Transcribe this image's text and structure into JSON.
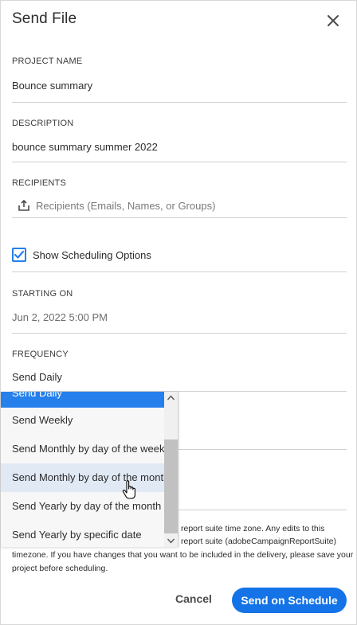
{
  "dialog": {
    "title": "Send File",
    "close_icon": "close-icon"
  },
  "project_name": {
    "label": "PROJECT NAME",
    "value": "Bounce summary"
  },
  "description": {
    "label": "DESCRIPTION",
    "value": "bounce summary summer 2022"
  },
  "recipients": {
    "label": "RECIPIENTS",
    "placeholder": "Recipients (Emails, Names, or Groups)",
    "icon": "share-icon"
  },
  "scheduling": {
    "checkbox_label": "Show Scheduling Options",
    "checked": true
  },
  "starting_on": {
    "label": "STARTING ON",
    "value": "Jun 2, 2022 5:00 PM"
  },
  "frequency": {
    "label": "FREQUENCY",
    "value": "Send Daily",
    "options": [
      "Send Daily",
      "Send Weekly",
      "Send Monthly by day of the week",
      "Send Monthly by day of the month",
      "Send Yearly by day of the month",
      "Send Yearly by specific date"
    ],
    "selected_option": "Send Daily",
    "hovered_option": "Send Monthly by day of the month"
  },
  "note": {
    "line1": "report suite time zone. Any edits to this",
    "line2": "report suite (adobeCampaignReportSuite)",
    "line3": "timezone. If you have changes that you want to be included in the delivery, please save your",
    "line4": "project before scheduling."
  },
  "footer": {
    "cancel_label": "Cancel",
    "send_label": "Send on Schedule"
  },
  "colors": {
    "accent": "#1473e6",
    "selected_option": "#2680eb"
  }
}
